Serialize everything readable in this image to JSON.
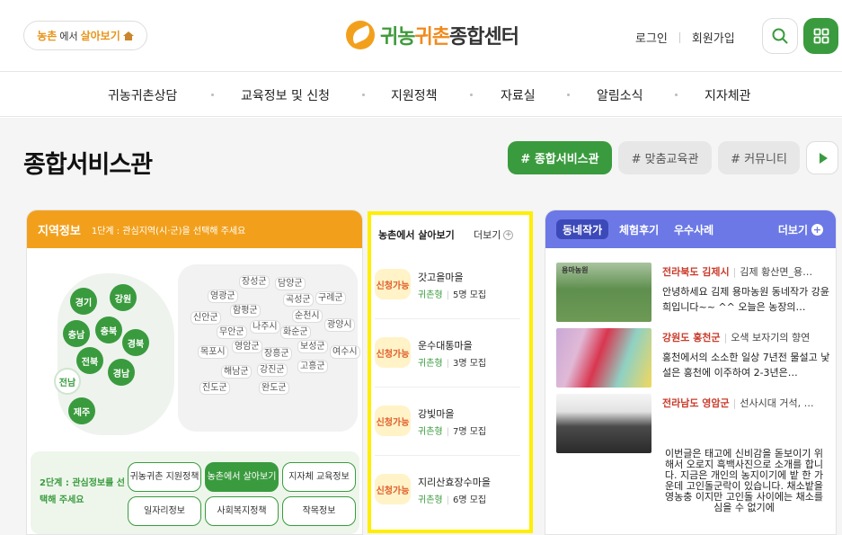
{
  "header": {
    "village_pill": {
      "part1": "농촌",
      "part2": "에서",
      "part3": "살아보기"
    },
    "logo": {
      "g": "귀농",
      "o": "귀촌",
      "d": "종합센터"
    },
    "login": "로그인",
    "signup": "회원가입"
  },
  "nav": {
    "items": [
      "귀농귀촌상담",
      "교육정보 및 신청",
      "지원정책",
      "자료실",
      "알림소식",
      "지자체관"
    ]
  },
  "page": {
    "title": "종합서비스관",
    "tabs": [
      "# 종합서비스관",
      "# 맞춤교육관",
      "# 커뮤니티"
    ]
  },
  "region": {
    "title": "지역정보",
    "desc": "1단계 : 관심지역(시·군)을 선택해 주세요",
    "provinces": [
      "경기",
      "강원",
      "충남",
      "충북",
      "경북",
      "전북",
      "경남",
      "전남",
      "제주"
    ],
    "counties": [
      "장성군",
      "담양군",
      "영광군",
      "곡성군",
      "구례군",
      "함평군",
      "신안군",
      "순천시",
      "나주시",
      "광양시",
      "화순군",
      "무안군",
      "영암군",
      "보성군",
      "목포시",
      "장흥군",
      "여수시",
      "해남군",
      "강진군",
      "고흥군",
      "진도군",
      "완도군"
    ],
    "step2_label": "2단계 : 관심정보를 선택해 주세요",
    "categories": [
      {
        "label": "귀농귀촌 지원정책"
      },
      {
        "label": "농촌에서 살아보기"
      },
      {
        "label": "지자체 교육정보"
      },
      {
        "label": "일자리정보"
      },
      {
        "label": "사회복지정책"
      },
      {
        "label": "작목정보"
      }
    ]
  },
  "villages": {
    "title": "농촌에서 살아보기",
    "more": "더보기",
    "items": [
      {
        "badge": "신청가능",
        "name": "갓고을마을",
        "type": "귀촌형",
        "count": "5명 모집"
      },
      {
        "badge": "신청가능",
        "name": "운수대통마을",
        "type": "귀촌형",
        "count": "3명 모집"
      },
      {
        "badge": "신청가능",
        "name": "강빛마을",
        "type": "귀촌형",
        "count": "7명 모집"
      },
      {
        "badge": "신청가능",
        "name": "지리산효장수마을",
        "type": "귀촌형",
        "count": "6명 모집"
      }
    ]
  },
  "stories": {
    "tabs": [
      "동네작가",
      "체험후기",
      "우수사례"
    ],
    "more": "더보기",
    "items": [
      {
        "thumb_label": "용마농원",
        "location": "전라북도 김제시",
        "title": "김제 황산면_용…",
        "body": "안녕하세요 김제 용마농원 동네작가 강윤희입니다~~ ^^ 오늘은 농장의…"
      },
      {
        "location": "강원도 홍천군",
        "title": "오색 보자기의 향연",
        "body": "홍천에서의 소소한 일상 7년전 물설고 낯설은 홍천에 이주하여 2-3년은…"
      },
      {
        "location": "전라남도 영암군",
        "title": "선사시대 거석, …",
        "body": ""
      }
    ],
    "extra_text": "이번글은 태고에 신비감을 돋보이기 위해서 오로지 흑백사진으로 소개를 합니다. 지금은 개인의 농지이기에 밭 한 가운데 고인돌군락이 있습니다. 채소밭을 영농충 이지만 고인돌 사이에는 채소를 심을 수 없기에"
  }
}
